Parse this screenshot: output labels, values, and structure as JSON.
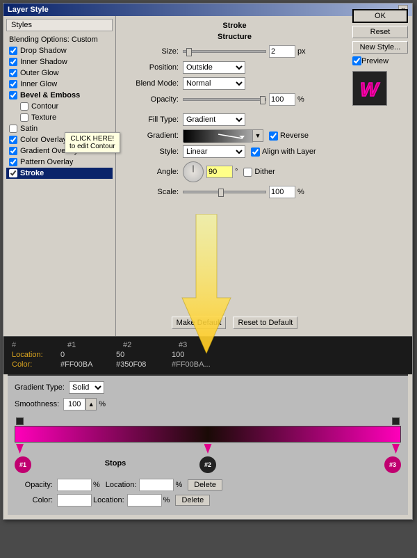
{
  "dialog": {
    "title": "Layer Style",
    "close_btn": "×"
  },
  "left_panel": {
    "styles_header": "Styles",
    "blending_options": "Blending Options: Custom",
    "items": [
      {
        "id": "drop-shadow",
        "label": "Drop Shadow",
        "checked": true,
        "active": false
      },
      {
        "id": "inner-shadow",
        "label": "Inner Shadow",
        "checked": true,
        "active": false
      },
      {
        "id": "outer-glow",
        "label": "Outer Glow",
        "checked": true,
        "active": false
      },
      {
        "id": "inner-glow",
        "label": "Inner Glow",
        "checked": true,
        "active": false
      },
      {
        "id": "bevel-emboss",
        "label": "Bevel & Emboss",
        "checked": true,
        "active": false
      },
      {
        "id": "contour",
        "label": "Contour",
        "checked": false,
        "active": false,
        "indent": true
      },
      {
        "id": "texture",
        "label": "Texture",
        "checked": false,
        "active": false,
        "indent": true
      },
      {
        "id": "satin",
        "label": "Satin",
        "checked": false,
        "active": false
      },
      {
        "id": "color-overlay",
        "label": "Color Overlay",
        "checked": true,
        "active": false
      },
      {
        "id": "gradient-overlay",
        "label": "Gradient Overlay",
        "checked": true,
        "active": false
      },
      {
        "id": "pattern-overlay",
        "label": "Pattern Overlay",
        "checked": true,
        "active": false
      },
      {
        "id": "stroke",
        "label": "Stroke",
        "checked": true,
        "active": true
      }
    ]
  },
  "tooltip": {
    "line1": "CLICK HERE!",
    "line2": "to edit Contour"
  },
  "stroke_panel": {
    "section_title": "Stroke",
    "sub_title": "Structure",
    "size_label": "Size:",
    "size_value": "2",
    "size_unit": "px",
    "position_label": "Position:",
    "position_value": "Outside",
    "blend_mode_label": "Blend Mode:",
    "blend_mode_value": "Normal",
    "opacity_label": "Opacity:",
    "opacity_value": "100",
    "opacity_unit": "%",
    "fill_type_label": "Fill Type:",
    "fill_type_value": "Gradient",
    "gradient_label": "Gradient:",
    "reverse_label": "Reverse",
    "reverse_checked": true,
    "style_label": "Style:",
    "style_value": "Linear",
    "align_label": "Align with Layer",
    "align_checked": true,
    "angle_label": "Angle:",
    "angle_value": "90",
    "dither_label": "Dither",
    "dither_checked": false,
    "scale_label": "Scale:",
    "scale_value": "100",
    "scale_unit": "%",
    "make_default_btn": "Make Default",
    "reset_default_btn": "Reset to Default"
  },
  "right_buttons": {
    "ok": "OK",
    "reset": "Reset",
    "new_style": "New Style...",
    "preview_label": "Preview"
  },
  "bottom_panel": {
    "headers": [
      "#",
      "#1",
      "#2",
      "#3"
    ],
    "location_label": "Location:",
    "location_values": [
      "0",
      "50",
      "100"
    ],
    "color_label": "Color:",
    "color_values": [
      "#FF00BA",
      "#350F08",
      "#FF00BA"
    ]
  },
  "gradient_editor": {
    "type_label": "Gradient Type:",
    "type_value": "Solid",
    "smoothness_label": "Smoothness:",
    "smoothness_value": "100",
    "smoothness_unit": "%",
    "stops_label": "Stops",
    "opacity_label": "Opacity:",
    "opacity_value": "",
    "opacity_unit": "%",
    "location_label": "Location:",
    "location_value": "",
    "location_unit": "%",
    "delete_btn": "Delete",
    "color_label": "Color:",
    "color_value": "",
    "color_location_label": "Location:",
    "color_location_value": "",
    "color_location_unit": "%",
    "color_delete_btn": "Delete"
  }
}
